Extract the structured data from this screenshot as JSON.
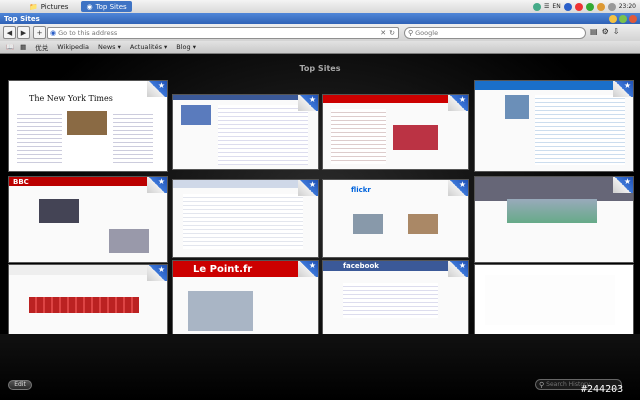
{
  "menubar": {
    "app_tabs": [
      {
        "label": "Pictures"
      },
      {
        "label": "Top Sites"
      }
    ],
    "lang": "EN",
    "clock": "23:20"
  },
  "window": {
    "title": "Top Sites"
  },
  "toolbar": {
    "address_placeholder": "Go to this address",
    "search_placeholder": "Google"
  },
  "bookmarks": [
    "优兑",
    "Wikipedia",
    "News ▾",
    "Actualités ▾",
    "Blog ▾"
  ],
  "page": {
    "heading": "Top Sites"
  },
  "thumbnails": [
    {
      "label": "The New York Times"
    },
    {
      "label": ""
    },
    {
      "label": ""
    },
    {
      "label": ""
    },
    {
      "label": "BBC"
    },
    {
      "label": ""
    },
    {
      "label": "flickr"
    },
    {
      "label": ""
    },
    {
      "label": ""
    },
    {
      "label": "Le Point.fr"
    },
    {
      "label": "facebook"
    },
    {
      "label": ""
    }
  ],
  "footer": {
    "edit_label": "Edit",
    "history_placeholder": "Search History"
  },
  "watermark": "#244203"
}
